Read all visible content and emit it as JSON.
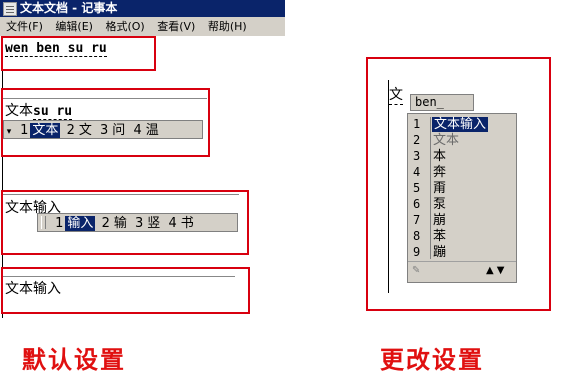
{
  "window": {
    "title": "文本文档 - 记事本"
  },
  "menu": [
    "文件(F)",
    "编辑(E)",
    "格式(O)",
    "查看(V)",
    "帮助(H)"
  ],
  "left": {
    "box1_text": "wen ben su ru",
    "box2": {
      "text_a": "文本",
      "text_b": "su ru",
      "arrow": "▾",
      "candidates": [
        {
          "num": "1",
          "text": "文本",
          "selected": true
        },
        {
          "num": "2",
          "text": "文"
        },
        {
          "num": "3",
          "text": "问"
        },
        {
          "num": "4",
          "text": "温"
        }
      ]
    },
    "box3": {
      "text": "文本输入",
      "candidates": [
        {
          "num": "1",
          "text": "输入",
          "selected": true
        },
        {
          "num": "2",
          "text": "输"
        },
        {
          "num": "3",
          "text": "竖"
        },
        {
          "num": "4",
          "text": "书"
        }
      ]
    },
    "box4_text": "文本输入",
    "caption": "默认设置"
  },
  "right": {
    "typed": "文",
    "pinyin": "ben_",
    "list": [
      {
        "num": "1",
        "text": "文本输入",
        "selected": true
      },
      {
        "num": "2",
        "text": "文本"
      },
      {
        "num": "3",
        "text": "本"
      },
      {
        "num": "4",
        "text": "奔"
      },
      {
        "num": "5",
        "text": "甭"
      },
      {
        "num": "6",
        "text": "泵"
      },
      {
        "num": "7",
        "text": "崩"
      },
      {
        "num": "8",
        "text": "苯"
      },
      {
        "num": "9",
        "text": "蹦"
      }
    ],
    "nav": "▲▼",
    "caption": "更改设置"
  },
  "colors": {
    "accent_red": "#d8000f",
    "selection": "#0a246a",
    "caption_red": "#e01010"
  }
}
